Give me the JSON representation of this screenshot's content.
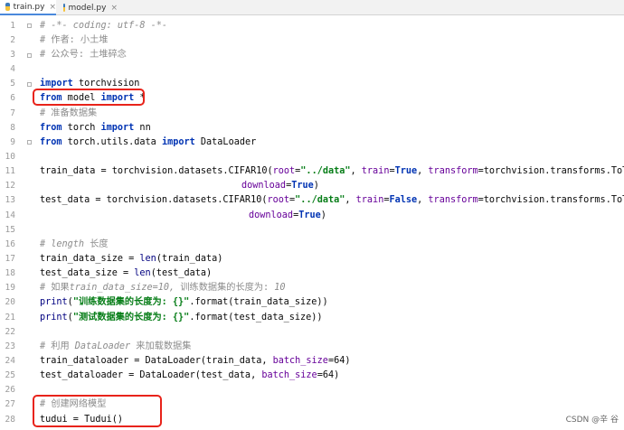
{
  "tabs": [
    {
      "label": "train.py",
      "active": true
    },
    {
      "label": "model.py",
      "active": false
    }
  ],
  "close_glyph": "×",
  "line_numbers": [
    "1",
    "2",
    "3",
    "4",
    "5",
    "6",
    "7",
    "8",
    "9",
    "10",
    "11",
    "12",
    "13",
    "14",
    "15",
    "16",
    "17",
    "18",
    "19",
    "20",
    "21",
    "22",
    "23",
    "24",
    "25",
    "26",
    "27",
    "28"
  ],
  "code": {
    "l1": "# -*- coding: utf-8 -*-",
    "l2": "# 作者: 小土堆",
    "l3": "# 公众号: 土堆碎念",
    "l5_kw": "import",
    "l5_rest": " torchvision",
    "l6_kw1": "from",
    "l6_mid": " model ",
    "l6_kw2": "import",
    "l6_rest": " *",
    "l7": "# 准备数据集",
    "l8_kw1": "from",
    "l8_mid": " torch ",
    "l8_kw2": "import",
    "l8_rest": " nn",
    "l9_kw1": "from",
    "l9_mid": " torch.utils.data ",
    "l9_kw2": "import",
    "l9_rest": " DataLoader",
    "l11_a": "train_data = torchvision.datasets.CIFAR10(",
    "l11_p1": "root",
    "l11_b": "=",
    "l11_s1": "\"../data\"",
    "l11_c": ", ",
    "l11_p2": "train",
    "l11_d": "=",
    "l11_k": "True",
    "l11_e": ", ",
    "l11_p3": "transform",
    "l11_f": "=torchvision.transforms.ToTensor(),",
    "l12_p": "download",
    "l12_a": "=",
    "l12_k": "True",
    "l12_b": ")",
    "l13_a": "test_data = torchvision.datasets.CIFAR10(",
    "l13_p1": "root",
    "l13_b": "=",
    "l13_s1": "\"../data\"",
    "l13_c": ", ",
    "l13_p2": "train",
    "l13_d": "=",
    "l13_k": "False",
    "l13_e": ", ",
    "l13_p3": "transform",
    "l13_f": "=torchvision.transforms.ToTensor(),",
    "l14_p": "download",
    "l14_a": "=",
    "l14_k": "True",
    "l14_b": ")",
    "l16_c1": "# length",
    "l16_c2": " 长度",
    "l17_a": "train_data_size = ",
    "l17_b": "len",
    "l17_c": "(train_data)",
    "l18_a": "test_data_size = ",
    "l18_b": "len",
    "l18_c": "(test_data)",
    "l19_c1": "# 如果",
    "l19_c2": "train_data_size=10,",
    "l19_c3": " 训练数据集的长度为: ",
    "l19_c4": "10",
    "l20_a": "print",
    "l20_b": "(",
    "l20_s": "\"训练数据集的长度为: {}\"",
    "l20_c": ".format(train_data_size))",
    "l21_a": "print",
    "l21_b": "(",
    "l21_s": "\"测试数据集的长度为: {}\"",
    "l21_c": ".format(test_data_size))",
    "l23_c1": "# 利用 ",
    "l23_c2": "DataLoader",
    "l23_c3": " 来加载数据集",
    "l24_a": "train_dataloader = DataLoader(train_data, ",
    "l24_p": "batch_size",
    "l24_b": "=64)",
    "l25_a": "test_dataloader = DataLoader(test_data, ",
    "l25_p": "batch_size",
    "l25_b": "=64)",
    "l27": "# 创建网络模型",
    "l28": "tudui = Tudui()"
  },
  "watermark": "CSDN @辛 谷",
  "colors": {
    "highlight": "#e8231a",
    "keyword": "#0033b3",
    "comment": "#8c8c8c",
    "string": "#067d17",
    "param": "#660099"
  }
}
